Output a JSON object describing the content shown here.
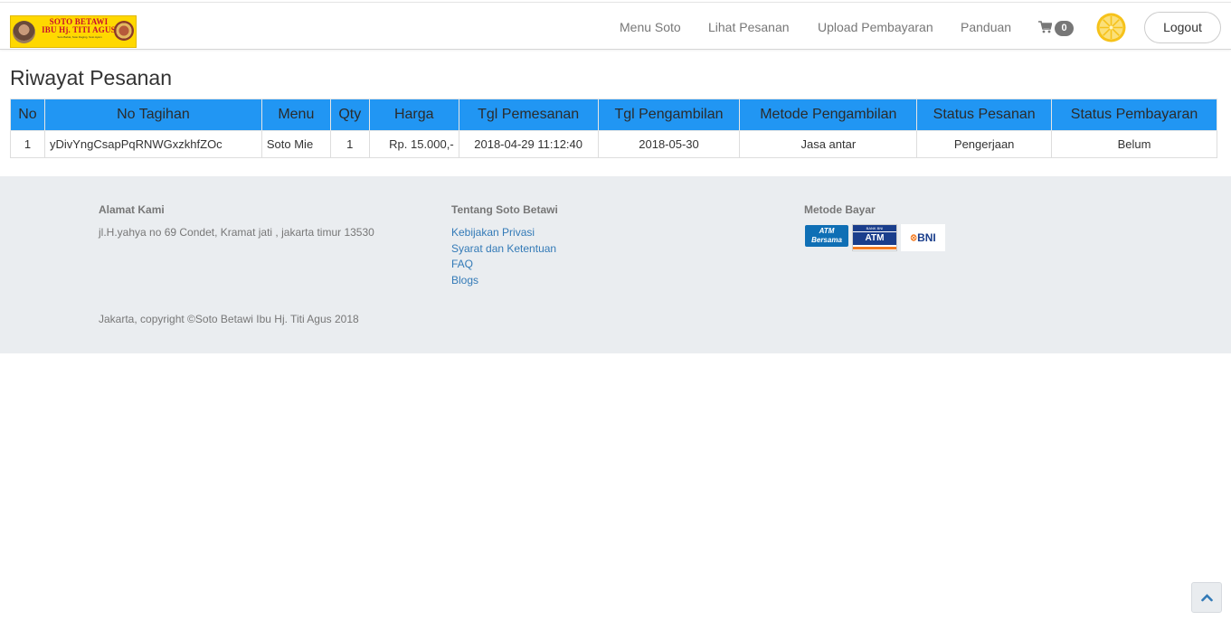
{
  "brand": {
    "logo_line1": "SOTO BETAWI",
    "logo_line2": "IBU Hj. TITI AGUS",
    "logo_small": "Soto Babat, Soto Daging, Soto Ayam"
  },
  "nav": {
    "items": [
      {
        "label": "Menu Soto"
      },
      {
        "label": "Lihat Pesanan"
      },
      {
        "label": "Upload Pembayaran"
      },
      {
        "label": "Panduan"
      }
    ],
    "cart_count": "0",
    "logout_label": "Logout"
  },
  "page": {
    "title": "Riwayat Pesanan"
  },
  "orders": {
    "headers": [
      "No",
      "No Tagihan",
      "Menu",
      "Qty",
      "Harga",
      "Tgl Pemesanan",
      "Tgl Pengambilan",
      "Metode Pengambilan",
      "Status Pesanan",
      "Status Pembayaran"
    ],
    "rows": [
      {
        "no": "1",
        "invoice": "yDivYngCsapPqRNWGxzkhfZOc",
        "menu": "Soto Mie",
        "qty": "1",
        "price": "Rp. 15.000,-",
        "order_date": "2018-04-29 11:12:40",
        "pickup_date": "2018-05-30",
        "pickup_method": "Jasa antar",
        "order_status": "Pengerjaan",
        "payment_status": "Belum"
      }
    ]
  },
  "footer": {
    "address_heading": "Alamat Kami",
    "address_text": "jl.H.yahya no 69 Condet, Kramat jati , jakarta timur 13530",
    "about_heading": "Tentang Soto Betawi",
    "links": [
      "Kebijakan Privasi",
      "Syarat dan Ketentuan",
      "FAQ",
      "Blogs"
    ],
    "payment_heading": "Metode Bayar",
    "payment_logos": {
      "atm_bersama_line1": "ATM",
      "atm_bersama_line2": "Bersama",
      "bni_atm_top": "BANK BNI",
      "bni_atm_main": "ATM",
      "bni_text": "BNI",
      "bni_mark": "ꕕ"
    },
    "copyright": "Jakarta, copyright ©Soto Betawi Ibu Hj. Titi Agus 2018"
  },
  "colors": {
    "table_header": "#2196f3",
    "footer_bg": "#eaedf0",
    "link": "#337ab7"
  }
}
